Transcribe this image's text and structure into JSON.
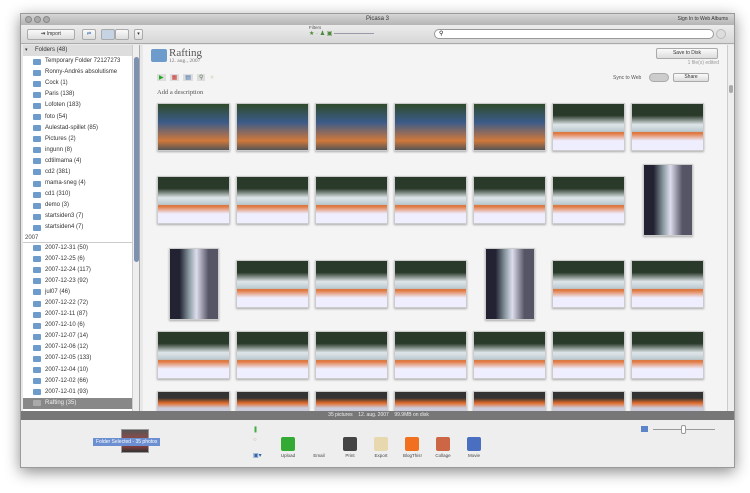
{
  "window": {
    "title": "Picasa 3",
    "sign_in": "Sign In to Web Albums"
  },
  "toolbar": {
    "import": "Import",
    "filters_label": "Filters",
    "search_placeholder": ""
  },
  "sidebar": {
    "folders_header": "Folders (48)",
    "folders": [
      "Temporary Folder 72127273",
      "Ronny-Andrés absolutisme",
      "Cock (1)",
      "Paris (138)",
      "Lofoten (183)",
      "foto (54)",
      "Aulestad-spillet (85)",
      "Pictures (2)",
      "ingunn (8)",
      "cdtilmama (4)",
      "cd2 (381)",
      "mama-sneg (4)",
      "cd1 (310)",
      "demo (3)",
      "startsiden3 (7)",
      "startsiden4 (7)"
    ],
    "year": "2007",
    "year_folders": [
      "2007-12-31 (50)",
      "2007-12-25 (6)",
      "2007-12-24 (117)",
      "2007-12-23 (92)",
      "jul07 (46)",
      "2007-12-22 (72)",
      "2007-12-11 (87)",
      "2007-12-10 (6)",
      "2007-12-07 (14)",
      "2007-12-06 (12)",
      "2007-12-05 (133)",
      "2007-12-04 (10)",
      "2007-12-02 (66)",
      "2007-12-01 (93)"
    ],
    "selected": "Rafting (35)"
  },
  "album": {
    "title": "Rafting",
    "date": "12. aug., 2007",
    "save": "Save to Disk",
    "edited": "1 file(s) edited",
    "sync": "Sync to Web",
    "share": "Share",
    "description": "Add a description"
  },
  "photos": [
    [
      "l",
      "g"
    ],
    [
      "l",
      "g"
    ],
    [
      "l",
      "g"
    ],
    [
      "l",
      "g"
    ],
    [
      "l",
      "g"
    ],
    [
      "l",
      "w"
    ],
    [
      "l",
      "w"
    ],
    [
      "l",
      "w"
    ],
    [
      "l",
      "w"
    ],
    [
      "l",
      "w"
    ],
    [
      "l",
      "w"
    ],
    [
      "l",
      "w"
    ],
    [
      "l",
      "w"
    ],
    [
      "p",
      "r"
    ],
    [
      "p",
      "r"
    ],
    [
      "l",
      "w"
    ],
    [
      "l",
      "w"
    ],
    [
      "l",
      "w"
    ],
    [
      "p",
      "r"
    ],
    [
      "l",
      "w"
    ],
    [
      "l",
      "w"
    ],
    [
      "l",
      "w"
    ],
    [
      "l",
      "w"
    ],
    [
      "l",
      "w"
    ],
    [
      "l",
      "w"
    ],
    [
      "l",
      "w"
    ],
    [
      "l",
      "w"
    ],
    [
      "l",
      "w"
    ],
    [
      "l",
      "d"
    ],
    [
      "l",
      "d"
    ],
    [
      "l",
      "d"
    ],
    [
      "l",
      "d"
    ],
    [
      "l",
      "d"
    ],
    [
      "l",
      "d"
    ],
    [
      "l",
      "d"
    ]
  ],
  "status": {
    "count": "35 pictures",
    "date": "12. aug. 2007",
    "size": "99.9MB on disk"
  },
  "tray": {
    "label": "Folder Selected - 35 photos"
  },
  "actions": [
    "Upload",
    "Email",
    "Print",
    "Export",
    "BlogThis!",
    "Collage",
    "Movie"
  ]
}
